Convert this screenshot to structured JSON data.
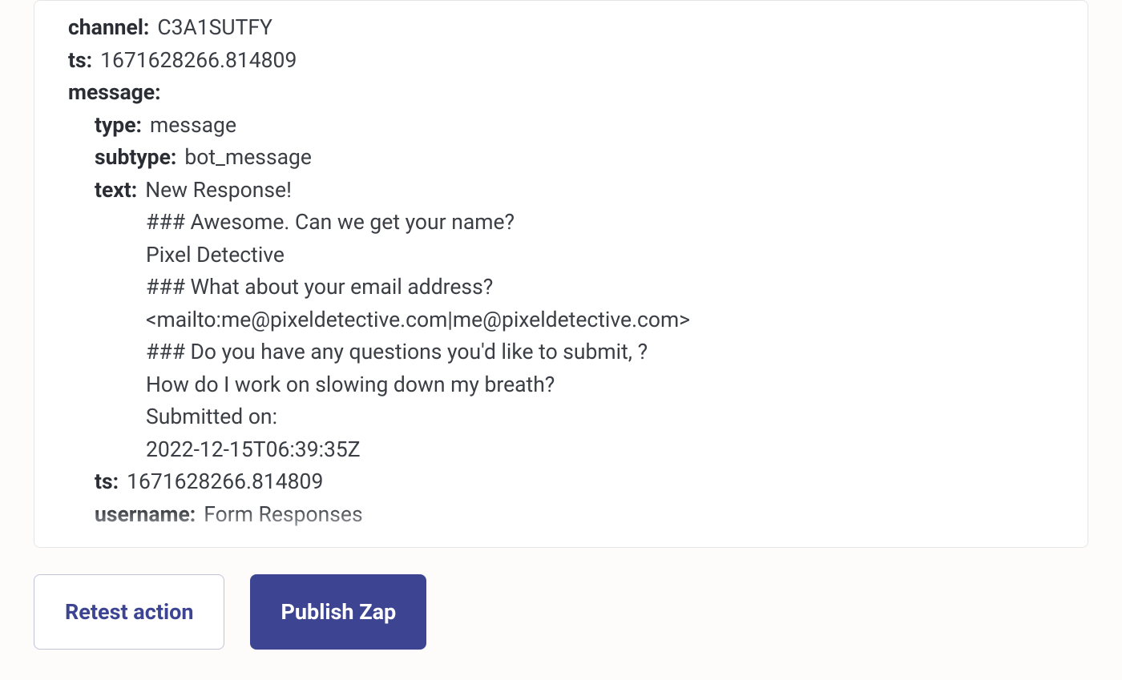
{
  "data_panel": {
    "channel": {
      "key": "channel",
      "value": "C3A1SUTFY"
    },
    "ts_outer": {
      "key": "ts",
      "value": "1671628266.814809"
    },
    "message": {
      "key": "message",
      "type": {
        "key": "type",
        "value": "message"
      },
      "subtype": {
        "key": "subtype",
        "value": "bot_message"
      },
      "text": {
        "key": "text",
        "first_line": "New Response!",
        "lines": [
          "### Awesome. Can we get your name?",
          "Pixel Detective",
          "### What about your email address?",
          "<mailto:me@pixeldetective.com|me@pixeldetective.com>",
          "### Do you have any questions you'd like to submit, ?",
          "How do I work on slowing down my breath?",
          "Submitted on:",
          "2022-12-15T06:39:35Z"
        ]
      },
      "ts_inner": {
        "key": "ts",
        "value": "1671628266.814809"
      },
      "username": {
        "key": "username",
        "value": "Form Responses"
      }
    }
  },
  "buttons": {
    "retest": "Retest action",
    "publish": "Publish Zap"
  }
}
